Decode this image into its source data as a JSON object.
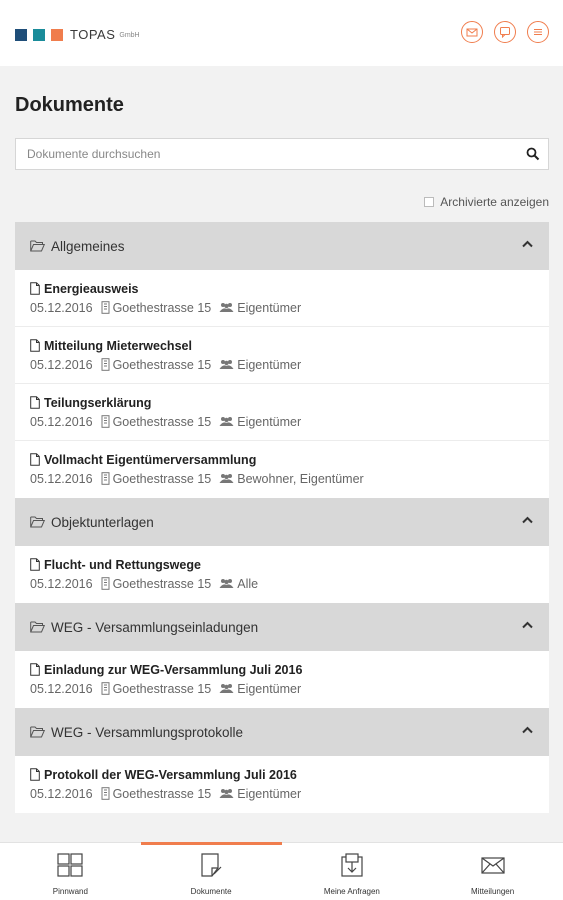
{
  "header": {
    "logo_name": "TOPAS",
    "logo_sub": "GmbH",
    "logo_colors": [
      "#1f4e79",
      "#1a8c9a",
      "#f07d4d"
    ],
    "icons": [
      "mail-icon",
      "chat-icon",
      "menu-icon"
    ],
    "accent": "#f07d4d"
  },
  "page": {
    "title": "Dokumente",
    "search_placeholder": "Dokumente durchsuchen",
    "archived_label": "Archivierte anzeigen",
    "archived_checked": false
  },
  "sections": [
    {
      "title": "Allgemeines",
      "docs": [
        {
          "title": "Energieausweis",
          "date": "05.12.2016",
          "property": "Goethestrasse 15",
          "audience": "Eigentümer"
        },
        {
          "title": "Mitteilung Mieterwechsel",
          "date": "05.12.2016",
          "property": "Goethestrasse 15",
          "audience": "Eigentümer"
        },
        {
          "title": "Teilungserklärung",
          "date": "05.12.2016",
          "property": "Goethestrasse 15",
          "audience": "Eigentümer"
        },
        {
          "title": "Vollmacht Eigentümerversammlung",
          "date": "05.12.2016",
          "property": "Goethestrasse 15",
          "audience": "Bewohner, Eigentümer"
        }
      ]
    },
    {
      "title": "Objektunterlagen",
      "docs": [
        {
          "title": "Flucht- und Rettungswege",
          "date": "05.12.2016",
          "property": "Goethestrasse 15",
          "audience": "Alle"
        }
      ]
    },
    {
      "title": "WEG - Versammlungseinladungen",
      "docs": [
        {
          "title": "Einladung zur WEG-Versammlung Juli 2016",
          "date": "05.12.2016",
          "property": "Goethestrasse 15",
          "audience": "Eigentümer"
        }
      ]
    },
    {
      "title": "WEG - Versammlungsprotokolle",
      "docs": [
        {
          "title": "Protokoll der WEG-Versammlung Juli 2016",
          "date": "05.12.2016",
          "property": "Goethestrasse 15",
          "audience": "Eigentümer"
        }
      ]
    }
  ],
  "nav": [
    {
      "label": "Pinnwand",
      "icon": "grid-icon",
      "active": false
    },
    {
      "label": "Dokumente",
      "icon": "document-edit-icon",
      "active": true
    },
    {
      "label": "Meine Anfragen",
      "icon": "requests-icon",
      "active": false
    },
    {
      "label": "Mitteilungen",
      "icon": "envelope-icon",
      "active": false
    }
  ]
}
